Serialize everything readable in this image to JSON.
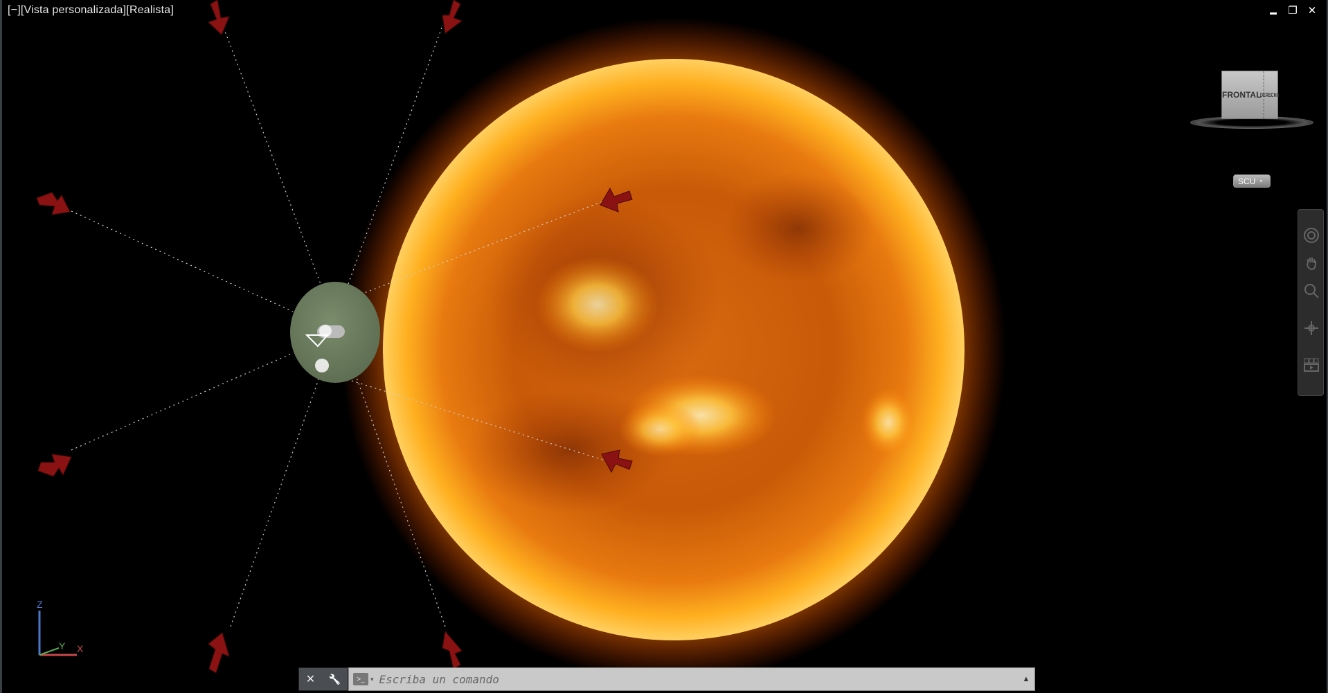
{
  "viewport": {
    "label_minus": "[−]",
    "label_view": "[Vista personalizada]",
    "label_style": "[Realista]"
  },
  "window_controls": {
    "minimize": "▬",
    "restore": "❐",
    "close": "✕"
  },
  "viewcube": {
    "front": "FRONTAL",
    "right": "DERECHA"
  },
  "ucs_badge": {
    "label": "SCU",
    "caret": "▾"
  },
  "ucs_axes": {
    "x": "X",
    "y": "Y",
    "z": "Z"
  },
  "command_line": {
    "placeholder": "Escriba un comando",
    "value": "",
    "close_icon": "✕",
    "customize_icon": "🔧",
    "prompt_icon": ">_",
    "prompt_dropdown": "▾",
    "history_icon": "▲"
  },
  "colors": {
    "background": "#000000",
    "sun_core": "#e8720c",
    "sun_glow": "#ffb000",
    "arrow": "#8b1212",
    "earth": "#6b7c5e"
  },
  "icons": [
    "minimize-icon",
    "restore-icon",
    "close-icon",
    "viewcube",
    "steering-wheel-icon",
    "pan-hand-icon",
    "zoom-icon",
    "orbit-icon",
    "showmotion-icon",
    "ucs-icon",
    "wrench-icon",
    "command-prompt-icon"
  ]
}
